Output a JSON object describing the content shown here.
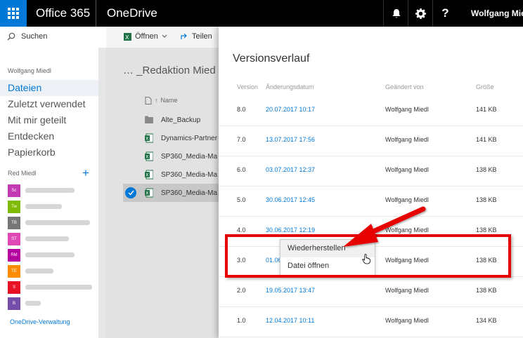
{
  "topbar": {
    "brand": "Office 365",
    "app_name": "OneDrive",
    "user_name": "Wolfgang Miedl",
    "icons": [
      "waffle-icon",
      "bell-icon",
      "gear-icon",
      "help-icon"
    ],
    "help_label": "?"
  },
  "leftnav": {
    "search_label": "Suchen",
    "user_name": "Wolfgang Miedl",
    "items": [
      {
        "label": "Dateien",
        "active": true
      },
      {
        "label": "Zuletzt verwendet"
      },
      {
        "label": "Mit mir geteilt"
      },
      {
        "label": "Entdecken"
      },
      {
        "label": "Papierkorb"
      }
    ],
    "groups_title": "Red Miedl",
    "groups": [
      {
        "badge": "Sc",
        "color": "#c239b3"
      },
      {
        "badge": "Tw",
        "color": "#7fba00"
      },
      {
        "badge": "TB",
        "color": "#767676"
      },
      {
        "badge": "ST",
        "color": "#e048b4"
      },
      {
        "badge": "RM",
        "color": "#b4009e"
      },
      {
        "badge": "TE",
        "color": "#ff8c00"
      },
      {
        "badge": "S",
        "color": "#e81123"
      },
      {
        "badge": "B",
        "color": "#744da9"
      }
    ],
    "admin_link": "OneDrive-Verwaltung"
  },
  "commands": {
    "open_label": "Öffnen",
    "share_label": "Teilen"
  },
  "main": {
    "breadcrumb": "… _Redaktion Mied",
    "column_name": "Name",
    "files": [
      {
        "name": "Alte_Backup",
        "type": "folder"
      },
      {
        "name": "Dynamics-Partner",
        "type": "excel"
      },
      {
        "name": "SP360_Media-Ma",
        "type": "excel"
      },
      {
        "name": "SP360_Media-Ma",
        "type": "excel"
      },
      {
        "name": "SP360_Media-Ma",
        "type": "excel",
        "selected": true
      }
    ]
  },
  "panel": {
    "title": "Versionsverlauf",
    "columns": {
      "version": "Version",
      "date": "Änderungsdatum",
      "modified_by": "Geändert von",
      "size": "Größe"
    },
    "rows": [
      {
        "version": "8.0",
        "date": "20.07.2017 10:17",
        "modified_by": "Wolfgang Miedl",
        "size": "141 KB"
      },
      {
        "version": "7.0",
        "date": "13.07.2017 17:56",
        "modified_by": "Wolfgang Miedl",
        "size": "141 KB"
      },
      {
        "version": "6.0",
        "date": "03.07.2017 12:37",
        "modified_by": "Wolfgang Miedl",
        "size": "138 KB"
      },
      {
        "version": "5.0",
        "date": "30.06.2017 12:45",
        "modified_by": "Wolfgang Miedl",
        "size": "138 KB"
      },
      {
        "version": "4.0",
        "date": "30.06.2017 12:19",
        "modified_by": "Wolfgang Miedl",
        "size": "138 KB"
      },
      {
        "version": "3.0",
        "date": "01.06",
        "modified_by": "Wolfgang Miedl",
        "size": "138 KB"
      },
      {
        "version": "2.0",
        "date": "19.05.2017 13:47",
        "modified_by": "Wolfgang Miedl",
        "size": "138 KB"
      },
      {
        "version": "1.0",
        "date": "12.04.2017 10:11",
        "modified_by": "Wolfgang Miedl",
        "size": "134 KB"
      }
    ]
  },
  "context_menu": {
    "items": [
      {
        "label": "Wiederherstellen",
        "hover": true
      },
      {
        "label": "Datei öffnen"
      }
    ]
  },
  "annotation": {
    "highlight_color": "#e60000"
  }
}
